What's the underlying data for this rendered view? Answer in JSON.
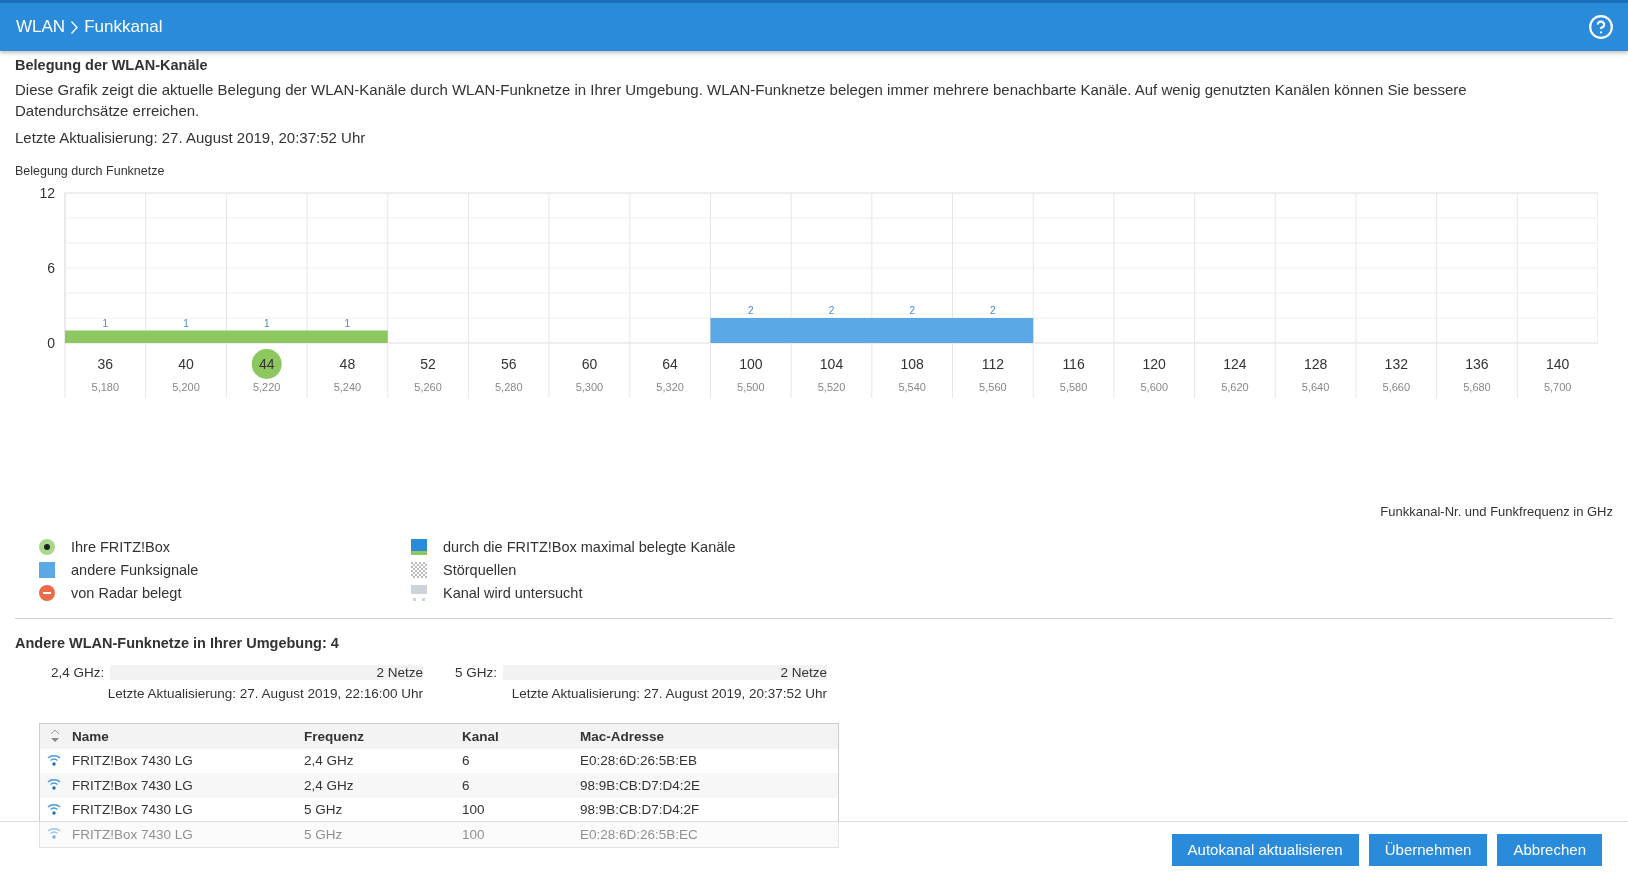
{
  "header": {
    "breadcrumb": [
      "WLAN",
      "Funkkanal"
    ]
  },
  "section_title": "Belegung der WLAN-Kanäle",
  "description": "Diese Grafik zeigt die aktuelle Belegung der WLAN-Kanäle durch WLAN-Funknetze in Ihrer Umgebung. WLAN-Funknetze belegen immer mehrere benachbarte Kanäle. Auf wenig genutzten Kanälen können Sie bessere Datendurchsätze erreichen.",
  "last_update": "Letzte Aktualisierung: 27. August 2019, 20:37:52 Uhr",
  "chart": {
    "ylabel": "Belegung durch Funknetze",
    "xlabel": "Funkkanal-Nr. und Funkfrequenz in GHz",
    "yticks": [
      "12",
      "6",
      "0"
    ],
    "channels": [
      {
        "number": "36",
        "frequency": "5,180",
        "selected": false,
        "count": "1",
        "color": "#8cc75f"
      },
      {
        "number": "40",
        "frequency": "5,200",
        "selected": false,
        "count": "1",
        "color": "#8cc75f"
      },
      {
        "number": "44",
        "frequency": "5,220",
        "selected": true,
        "count": "1",
        "color": "#8cc75f"
      },
      {
        "number": "48",
        "frequency": "5,240",
        "selected": false,
        "count": "1",
        "color": "#8cc75f"
      },
      {
        "number": "52",
        "frequency": "5,260",
        "selected": false
      },
      {
        "number": "56",
        "frequency": "5,280",
        "selected": false
      },
      {
        "number": "60",
        "frequency": "5,300",
        "selected": false
      },
      {
        "number": "64",
        "frequency": "5,320",
        "selected": false
      },
      {
        "number": "100",
        "frequency": "5,500",
        "selected": false,
        "count": "2",
        "color": "#5aa8e6"
      },
      {
        "number": "104",
        "frequency": "5,520",
        "selected": false,
        "count": "2",
        "color": "#5aa8e6"
      },
      {
        "number": "108",
        "frequency": "5,540",
        "selected": false,
        "count": "2",
        "color": "#5aa8e6"
      },
      {
        "number": "112",
        "frequency": "5,560",
        "selected": false,
        "count": "2",
        "color": "#5aa8e6"
      },
      {
        "number": "116",
        "frequency": "5,580",
        "selected": false
      },
      {
        "number": "120",
        "frequency": "5,600",
        "selected": false
      },
      {
        "number": "124",
        "frequency": "5,620",
        "selected": false
      },
      {
        "number": "128",
        "frequency": "5,640",
        "selected": false
      },
      {
        "number": "132",
        "frequency": "5,660",
        "selected": false
      },
      {
        "number": "136",
        "frequency": "5,680",
        "selected": false
      },
      {
        "number": "140",
        "frequency": "5,700",
        "selected": false
      }
    ]
  },
  "legend": [
    {
      "kind": "own",
      "label": "Ihre FRITZ!Box"
    },
    {
      "kind": "other",
      "label": "andere Funksignale"
    },
    {
      "kind": "radar",
      "label": "von Radar belegt"
    },
    {
      "kind": "max",
      "label": "durch die FRITZ!Box maximal belegte Kanäle"
    },
    {
      "kind": "interference",
      "label": "Störquellen"
    },
    {
      "kind": "scanning",
      "label": "Kanal wird untersucht"
    }
  ],
  "networks": {
    "title": "Andere WLAN-Funknetze in Ihrer Umgebung: 4",
    "bands": [
      {
        "label": "2,4 GHz:",
        "count": "2 Netze",
        "last_update": "Letzte Aktualisierung: 27. August 2019, 22:16:00 Uhr"
      },
      {
        "label": "5 GHz:",
        "count": "2 Netze",
        "last_update": "Letzte Aktualisierung: 27. August 2019, 20:37:52 Uhr"
      }
    ],
    "table": {
      "columns": [
        "Name",
        "Frequenz",
        "Kanal",
        "Mac-Adresse"
      ],
      "rows": [
        [
          "FRITZ!Box 7430 LG",
          "2,4 GHz",
          "6",
          "E0:28:6D:26:5B:EB"
        ],
        [
          "FRITZ!Box 7430 LG",
          "2,4 GHz",
          "6",
          "98:9B:CB:D7:D4:2E"
        ],
        [
          "FRITZ!Box 7430 LG",
          "5 GHz",
          "100",
          "98:9B:CB:D7:D4:2F"
        ],
        [
          "FRITZ!Box 7430 LG",
          "5 GHz",
          "100",
          "E0:28:6D:26:5B:EC"
        ]
      ]
    }
  },
  "buttons": [
    "Autokanal aktualisieren",
    "Übernehmen",
    "Abbrechen"
  ]
}
